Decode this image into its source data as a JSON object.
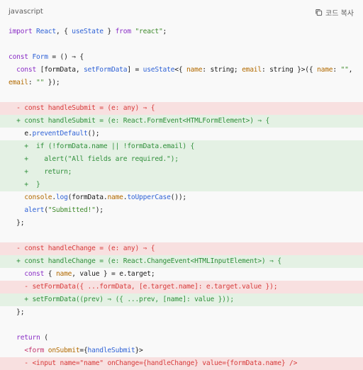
{
  "header": {
    "language": "javascript",
    "copy_label": "코드 복사",
    "copy_icon": "copy-icon"
  },
  "code_lines": [
    {
      "type": "normal",
      "text": "import React, { useState } from \"react\";"
    },
    {
      "type": "normal",
      "text": ""
    },
    {
      "type": "normal",
      "text": "const Form = () ⇒ {"
    },
    {
      "type": "normal",
      "text": "  const [formData, setFormData] = useState<{ name: string; email: string }>({ name: \"\","
    },
    {
      "type": "normal",
      "text": "email: \"\" });"
    },
    {
      "type": "normal",
      "text": ""
    },
    {
      "type": "del",
      "text": "  - const handleSubmit = (e: any) ⇒ {"
    },
    {
      "type": "add",
      "text": "  + const handleSubmit = (e: React.FormEvent<HTMLFormElement>) ⇒ {"
    },
    {
      "type": "normal",
      "text": "    e.preventDefault();"
    },
    {
      "type": "add",
      "text": "    +  if (!formData.name || !formData.email) {"
    },
    {
      "type": "add",
      "text": "    +    alert(\"All fields are required.\");"
    },
    {
      "type": "add",
      "text": "    +    return;"
    },
    {
      "type": "add",
      "text": "    +  }"
    },
    {
      "type": "normal",
      "text": "    console.log(formData.name.toUpperCase());"
    },
    {
      "type": "normal",
      "text": "    alert(\"Submitted!\");"
    },
    {
      "type": "normal",
      "text": "  };"
    },
    {
      "type": "normal",
      "text": ""
    },
    {
      "type": "del",
      "text": "  - const handleChange = (e: any) ⇒ {"
    },
    {
      "type": "add",
      "text": "  + const handleChange = (e: React.ChangeEvent<HTMLInputElement>) ⇒ {"
    },
    {
      "type": "normal",
      "text": "    const { name, value } = e.target;"
    },
    {
      "type": "del",
      "text": "    - setFormData({ ...formData, [e.target.name]: e.target.value });"
    },
    {
      "type": "add",
      "text": "    + setFormData((prev) ⇒ ({ ...prev, [name]: value }));"
    },
    {
      "type": "normal",
      "text": "  };"
    },
    {
      "type": "normal",
      "text": ""
    },
    {
      "type": "normal",
      "text": "  return ("
    },
    {
      "type": "normal",
      "text": "    <form onSubmit={handleSubmit}>"
    },
    {
      "type": "del",
      "text": "    - <input name=\"name\" onChange={handleChange} value={formData.name} />"
    }
  ],
  "colors": {
    "background": "#f9f9f9",
    "deleted_bg": "#f8e0e0",
    "deleted_text": "#d73a3a",
    "added_bg": "#e4f1e4",
    "added_text": "#2f8f3a"
  }
}
